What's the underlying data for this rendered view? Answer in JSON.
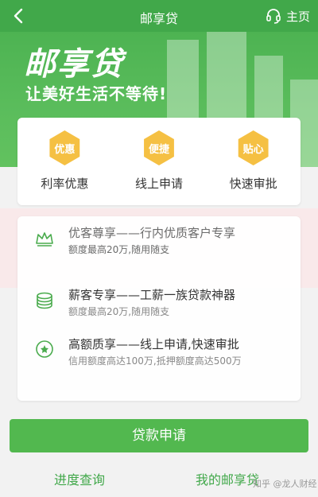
{
  "topbar": {
    "back_icon": "chevron-left-icon",
    "title": "邮享贷",
    "home_icon": "headset-icon",
    "home_label": "主页"
  },
  "banner": {
    "brand": "邮享贷",
    "slogan": "让美好生活不等待!"
  },
  "features": [
    {
      "badge": "优惠",
      "label": "利率优惠"
    },
    {
      "badge": "便捷",
      "label": "线上申请"
    },
    {
      "badge": "贴心",
      "label": "快速审批"
    }
  ],
  "products": [
    {
      "icon": "crown-icon",
      "title": "优客尊享——行内优质客户专享",
      "desc": "额度最高20万,随用随支"
    },
    {
      "icon": "coins-icon",
      "title": "薪客专享——工薪一族贷款神器",
      "desc": "额度最高20万,随用随支"
    },
    {
      "icon": "medal-icon",
      "title": "高额质享——线上申请,快速审批",
      "desc": "信用额度高达100万,抵押额度高达500万"
    }
  ],
  "actions": {
    "apply_label": "贷款申请",
    "progress_label": "进度查询",
    "my_label": "我的邮享贷"
  },
  "watermark": "知乎 @龙人财经",
  "colors": {
    "brand_green": "#41a84a",
    "badge_yellow": "#f5c043",
    "button_green": "#52b84f"
  }
}
